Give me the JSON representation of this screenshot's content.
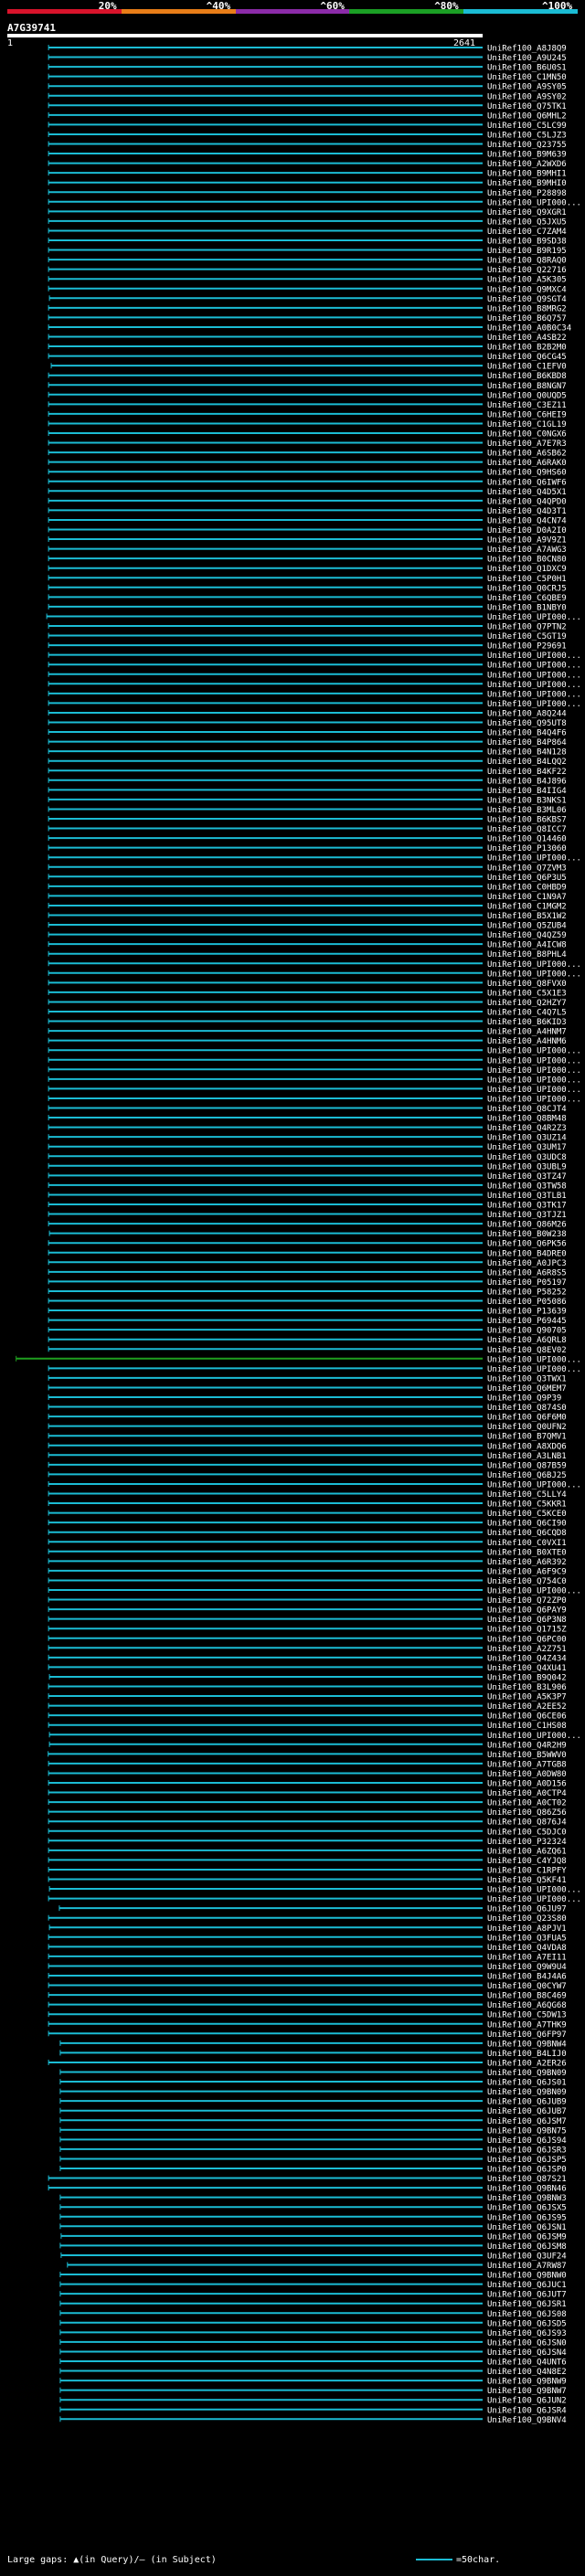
{
  "header": {
    "ticks": [
      "20%",
      "^40%",
      "^60%",
      "^80%",
      "^100%"
    ],
    "segment_colors": [
      "#d9132b",
      "#e87d18",
      "#8b2ba8",
      "#1b9f25",
      "#1bbcd4"
    ]
  },
  "query": {
    "id": "A7G39741",
    "start_label": "1",
    "end_label": "2641"
  },
  "colors": {
    "hit": "#1bbcd4",
    "gap_hit": "#1f9f1f",
    "query_bar": "#ffffff"
  },
  "footer": {
    "left": "Large gaps: ▲(in Query)/— (in Subject)",
    "right": "=50char."
  },
  "chart_data": {
    "type": "bar",
    "title": "A7G39741",
    "x_range": [
      1,
      2641
    ],
    "bar_end": 2641,
    "hits": [
      {
        "name": "UniRef100_A8J8Q9",
        "start": 230
      },
      {
        "name": "UniRef100_A9U245",
        "start": 230
      },
      {
        "name": "UniRef100_B6U0S1",
        "start": 230
      },
      {
        "name": "UniRef100_C1MN50",
        "start": 230
      },
      {
        "name": "UniRef100_A9SY05",
        "start": 230
      },
      {
        "name": "UniRef100_A9SY02",
        "start": 230
      },
      {
        "name": "UniRef100_Q75TK1",
        "start": 230
      },
      {
        "name": "UniRef100_Q6MHL2",
        "start": 230
      },
      {
        "name": "UniRef100_C5LC99",
        "start": 230
      },
      {
        "name": "UniRef100_C5LJZ3",
        "start": 230
      },
      {
        "name": "UniRef100_Q23755",
        "start": 230
      },
      {
        "name": "UniRef100_B9M639",
        "start": 230
      },
      {
        "name": "UniRef100_A2WXD6",
        "start": 230
      },
      {
        "name": "UniRef100_B9MHI1",
        "start": 230
      },
      {
        "name": "UniRef100_B9MHI0",
        "start": 230
      },
      {
        "name": "UniRef100_P28898",
        "start": 230
      },
      {
        "name": "UniRef100_UPI000...",
        "start": 230
      },
      {
        "name": "UniRef100_Q9XGR1",
        "start": 230
      },
      {
        "name": "UniRef100_Q5JXU5",
        "start": 230
      },
      {
        "name": "UniRef100_C7ZAM4",
        "start": 230
      },
      {
        "name": "UniRef100_B9SD38",
        "start": 230
      },
      {
        "name": "UniRef100_B9R195",
        "start": 230
      },
      {
        "name": "UniRef100_Q8RAQ0",
        "start": 230
      },
      {
        "name": "UniRef100_Q22716",
        "start": 230
      },
      {
        "name": "UniRef100_A5K305",
        "start": 230
      },
      {
        "name": "UniRef100_Q9MXC4",
        "start": 230
      },
      {
        "name": "UniRef100_Q9SGT4",
        "start": 235
      },
      {
        "name": "UniRef100_B8MRG2",
        "start": 230
      },
      {
        "name": "UniRef100_B6Q757",
        "start": 230
      },
      {
        "name": "UniRef100_A0B0C34",
        "start": 230
      },
      {
        "name": "UniRef100_A4SB22",
        "start": 230
      },
      {
        "name": "UniRef100_B2B2M0",
        "start": 230
      },
      {
        "name": "UniRef100_Q6CG45",
        "start": 230
      },
      {
        "name": "UniRef100_C1EFV0",
        "start": 245
      },
      {
        "name": "UniRef100_B6KBD8",
        "start": 230
      },
      {
        "name": "UniRef100_B8NGN7",
        "start": 230
      },
      {
        "name": "UniRef100_Q0UQD5",
        "start": 230
      },
      {
        "name": "UniRef100_C3EZ11",
        "start": 230
      },
      {
        "name": "UniRef100_C6HEI9",
        "start": 230
      },
      {
        "name": "UniRef100_C1GL19",
        "start": 230
      },
      {
        "name": "UniRef100_C0NGX6",
        "start": 230
      },
      {
        "name": "UniRef100_A7E7R3",
        "start": 230
      },
      {
        "name": "UniRef100_A6SB62",
        "start": 230
      },
      {
        "name": "UniRef100_A6RAK0",
        "start": 230
      },
      {
        "name": "UniRef100_Q9HS60",
        "start": 230
      },
      {
        "name": "UniRef100_Q6IWF6",
        "start": 230
      },
      {
        "name": "UniRef100_Q4D5X1",
        "start": 230
      },
      {
        "name": "UniRef100_Q4QPD0",
        "start": 230
      },
      {
        "name": "UniRef100_Q4D3T1",
        "start": 230
      },
      {
        "name": "UniRef100_Q4CN74",
        "start": 230
      },
      {
        "name": "UniRef100_D0A2I0",
        "start": 230
      },
      {
        "name": "UniRef100_A9V9Z1",
        "start": 230
      },
      {
        "name": "UniRef100_A7AWG3",
        "start": 230
      },
      {
        "name": "UniRef100_B0CN80",
        "start": 230
      },
      {
        "name": "UniRef100_Q1DXC9",
        "start": 230
      },
      {
        "name": "UniRef100_C5P0H1",
        "start": 230
      },
      {
        "name": "UniRef100_Q0CRJ5",
        "start": 230
      },
      {
        "name": "UniRef100_C6QBE9",
        "start": 230
      },
      {
        "name": "UniRef100_B1NBY0",
        "start": 230
      },
      {
        "name": "UniRef100_UPI000...",
        "start": 220
      },
      {
        "name": "UniRef100_Q7PTN2",
        "start": 230
      },
      {
        "name": "UniRef100_C5GT19",
        "start": 230
      },
      {
        "name": "UniRef100_P29691",
        "start": 230
      },
      {
        "name": "UniRef100_UPI000...",
        "start": 230
      },
      {
        "name": "UniRef100_UPI000...",
        "start": 230
      },
      {
        "name": "UniRef100_UPI000...",
        "start": 230
      },
      {
        "name": "UniRef100_UPI000...",
        "start": 230
      },
      {
        "name": "UniRef100_UPI000...",
        "start": 230
      },
      {
        "name": "UniRef100_UPI000...",
        "start": 230
      },
      {
        "name": "UniRef100_A8Q244",
        "start": 230
      },
      {
        "name": "UniRef100_Q95UT8",
        "start": 230
      },
      {
        "name": "UniRef100_B4Q4F6",
        "start": 230
      },
      {
        "name": "UniRef100_B4P864",
        "start": 230
      },
      {
        "name": "UniRef100_B4N128",
        "start": 230
      },
      {
        "name": "UniRef100_B4LQQ2",
        "start": 230
      },
      {
        "name": "UniRef100_B4KF22",
        "start": 230
      },
      {
        "name": "UniRef100_B4J896",
        "start": 230
      },
      {
        "name": "UniRef100_B4IIG4",
        "start": 230
      },
      {
        "name": "UniRef100_B3NKS1",
        "start": 230
      },
      {
        "name": "UniRef100_B3ML06",
        "start": 230
      },
      {
        "name": "UniRef100_B6KBS7",
        "start": 230
      },
      {
        "name": "UniRef100_Q8ICC7",
        "start": 230
      },
      {
        "name": "UniRef100_Q14460",
        "start": 230
      },
      {
        "name": "UniRef100_P13060",
        "start": 230
      },
      {
        "name": "UniRef100_UPI000...",
        "start": 230
      },
      {
        "name": "UniRef100_Q7ZVM3",
        "start": 230
      },
      {
        "name": "UniRef100_Q6P3U5",
        "start": 230
      },
      {
        "name": "UniRef100_C0HBD9",
        "start": 230
      },
      {
        "name": "UniRef100_C1N9A7",
        "start": 230
      },
      {
        "name": "UniRef100_C1MGM2",
        "start": 230
      },
      {
        "name": "UniRef100_B5X1W2",
        "start": 230
      },
      {
        "name": "UniRef100_Q5ZUB4",
        "start": 230
      },
      {
        "name": "UniRef100_Q4QZ59",
        "start": 230
      },
      {
        "name": "UniRef100_A4ICW8",
        "start": 230
      },
      {
        "name": "UniRef100_B8PHL4",
        "start": 230
      },
      {
        "name": "UniRef100_UPI000...",
        "start": 230
      },
      {
        "name": "UniRef100_UPI000...",
        "start": 230
      },
      {
        "name": "UniRef100_Q8FVX0",
        "start": 230
      },
      {
        "name": "UniRef100_C5X1E3",
        "start": 230
      },
      {
        "name": "UniRef100_Q2HZY7",
        "start": 230
      },
      {
        "name": "UniRef100_C4Q7L5",
        "start": 230
      },
      {
        "name": "UniRef100_B6KID3",
        "start": 230
      },
      {
        "name": "UniRef100_A4HNM7",
        "start": 230
      },
      {
        "name": "UniRef100_A4HNM6",
        "start": 230
      },
      {
        "name": "UniRef100_UPI000...",
        "start": 230
      },
      {
        "name": "UniRef100_UPI000...",
        "start": 230
      },
      {
        "name": "UniRef100_UPI000...",
        "start": 230
      },
      {
        "name": "UniRef100_UPI000...",
        "start": 230
      },
      {
        "name": "UniRef100_UPI000...",
        "start": 230
      },
      {
        "name": "UniRef100_UPI000...",
        "start": 230
      },
      {
        "name": "UniRef100_Q8CJT4",
        "start": 230
      },
      {
        "name": "UniRef100_Q8BM48",
        "start": 230
      },
      {
        "name": "UniRef100_Q4R2Z3",
        "start": 230
      },
      {
        "name": "UniRef100_Q3UZ14",
        "start": 230
      },
      {
        "name": "UniRef100_Q3UM17",
        "start": 230
      },
      {
        "name": "UniRef100_Q3UDC8",
        "start": 230
      },
      {
        "name": "UniRef100_Q3UBL9",
        "start": 230
      },
      {
        "name": "UniRef100_Q3TZ47",
        "start": 230
      },
      {
        "name": "UniRef100_Q3TW58",
        "start": 230
      },
      {
        "name": "UniRef100_Q3TLB1",
        "start": 230
      },
      {
        "name": "UniRef100_Q3TK17",
        "start": 230
      },
      {
        "name": "UniRef100_Q3TJZ1",
        "start": 230
      },
      {
        "name": "UniRef100_Q86M26",
        "start": 230
      },
      {
        "name": "UniRef100_B0W238",
        "start": 235
      },
      {
        "name": "UniRef100_Q6PK56",
        "start": 230
      },
      {
        "name": "UniRef100_B4DRE0",
        "start": 230
      },
      {
        "name": "UniRef100_A0JPC3",
        "start": 230
      },
      {
        "name": "UniRef100_A6R8S5",
        "start": 230
      },
      {
        "name": "UniRef100_P05197",
        "start": 230
      },
      {
        "name": "UniRef100_P58252",
        "start": 230
      },
      {
        "name": "UniRef100_P05086",
        "start": 230
      },
      {
        "name": "UniRef100_P13639",
        "start": 230
      },
      {
        "name": "UniRef100_P69445",
        "start": 230
      },
      {
        "name": "UniRef100_Q90705",
        "start": 230
      },
      {
        "name": "UniRef100_A6QRL8",
        "start": 230
      },
      {
        "name": "UniRef100_Q8EV02",
        "start": 230
      },
      {
        "name": "UniRef100_UPI000...",
        "start": 50,
        "gap": true
      },
      {
        "name": "UniRef100_UPI000...",
        "start": 230
      },
      {
        "name": "UniRef100_Q3TWX1",
        "start": 230
      },
      {
        "name": "UniRef100_Q6MEM7",
        "start": 230
      },
      {
        "name": "UniRef100_Q9P39",
        "start": 230
      },
      {
        "name": "UniRef100_Q874S0",
        "start": 230
      },
      {
        "name": "UniRef100_Q6F6M0",
        "start": 230
      },
      {
        "name": "UniRef100_Q0UFN2",
        "start": 230
      },
      {
        "name": "UniRef100_B7QMV1",
        "start": 230
      },
      {
        "name": "UniRef100_A8XDQ6",
        "start": 230
      },
      {
        "name": "UniRef100_A3LNB1",
        "start": 230
      },
      {
        "name": "UniRef100_Q87B59",
        "start": 230
      },
      {
        "name": "UniRef100_Q6BJ25",
        "start": 230
      },
      {
        "name": "UniRef100_UPI000...",
        "start": 230
      },
      {
        "name": "UniRef100_C5LLY4",
        "start": 230
      },
      {
        "name": "UniRef100_C5KKR1",
        "start": 230
      },
      {
        "name": "UniRef100_C5KCE0",
        "start": 230
      },
      {
        "name": "UniRef100_Q6CI90",
        "start": 230
      },
      {
        "name": "UniRef100_Q6CQD8",
        "start": 230
      },
      {
        "name": "UniRef100_C0VXI1",
        "start": 230
      },
      {
        "name": "UniRef100_B0XTE0",
        "start": 230
      },
      {
        "name": "UniRef100_A6R392",
        "start": 230
      },
      {
        "name": "UniRef100_A6F9C9",
        "start": 230
      },
      {
        "name": "UniRef100_Q754C0",
        "start": 230
      },
      {
        "name": "UniRef100_UPI000...",
        "start": 230
      },
      {
        "name": "UniRef100_Q72ZP0",
        "start": 230
      },
      {
        "name": "UniRef100_Q6PAY9",
        "start": 230
      },
      {
        "name": "UniRef100_Q6P3N8",
        "start": 230
      },
      {
        "name": "UniRef100_Q1715Z",
        "start": 230
      },
      {
        "name": "UniRef100_Q6PC00",
        "start": 230
      },
      {
        "name": "UniRef100_A2Z751",
        "start": 230
      },
      {
        "name": "UniRef100_Q4Z434",
        "start": 230
      },
      {
        "name": "UniRef100_Q4XU41",
        "start": 230
      },
      {
        "name": "UniRef100_B9Q042",
        "start": 235
      },
      {
        "name": "UniRef100_B3L906",
        "start": 230
      },
      {
        "name": "UniRef100_A5K3P7",
        "start": 230
      },
      {
        "name": "UniRef100_A2EE52",
        "start": 230
      },
      {
        "name": "UniRef100_Q6CE06",
        "start": 230
      },
      {
        "name": "UniRef100_C1HS08",
        "start": 230
      },
      {
        "name": "UniRef100_UPI000...",
        "start": 235
      },
      {
        "name": "UniRef100_Q4R2H9",
        "start": 235
      },
      {
        "name": "UniRef100_B5WWV0",
        "start": 228
      },
      {
        "name": "UniRef100_A7TGB8",
        "start": 230
      },
      {
        "name": "UniRef100_A0DW80",
        "start": 230
      },
      {
        "name": "UniRef100_A0D156",
        "start": 230
      },
      {
        "name": "UniRef100_A0CTP4",
        "start": 230
      },
      {
        "name": "UniRef100_A0CT02",
        "start": 230
      },
      {
        "name": "UniRef100_Q86Z56",
        "start": 230
      },
      {
        "name": "UniRef100_Q876J4",
        "start": 230
      },
      {
        "name": "UniRef100_C5DJC0",
        "start": 230
      },
      {
        "name": "UniRef100_P32324",
        "start": 230
      },
      {
        "name": "UniRef100_A6ZQ61",
        "start": 230
      },
      {
        "name": "UniRef100_C4YJQ8",
        "start": 230
      },
      {
        "name": "UniRef100_C1RPFY",
        "start": 230
      },
      {
        "name": "UniRef100_Q5KF41",
        "start": 230
      },
      {
        "name": "UniRef100_UPI000...",
        "start": 235
      },
      {
        "name": "UniRef100_UPI000...",
        "start": 230
      },
      {
        "name": "UniRef100_Q6JU97",
        "start": 290
      },
      {
        "name": "UniRef100_Q23S80",
        "start": 230
      },
      {
        "name": "UniRef100_A8PJV1",
        "start": 235
      },
      {
        "name": "UniRef100_Q3FUA5",
        "start": 230
      },
      {
        "name": "UniRef100_Q4VDA8",
        "start": 230
      },
      {
        "name": "UniRef100_A7EI11",
        "start": 230
      },
      {
        "name": "UniRef100_Q9W9U4",
        "start": 230
      },
      {
        "name": "UniRef100_B4J4A6",
        "start": 230
      },
      {
        "name": "UniRef100_Q0CYW7",
        "start": 230
      },
      {
        "name": "UniRef100_B8C469",
        "start": 230
      },
      {
        "name": "UniRef100_A6QG68",
        "start": 230
      },
      {
        "name": "UniRef100_C5DW13",
        "start": 230
      },
      {
        "name": "UniRef100_A7THK9",
        "start": 230
      },
      {
        "name": "UniRef100_Q6FP97",
        "start": 230
      },
      {
        "name": "UniRef100_Q9BNW4",
        "start": 295
      },
      {
        "name": "UniRef100_B4LIJ0",
        "start": 295
      },
      {
        "name": "UniRef100_A2ER26",
        "start": 230
      },
      {
        "name": "UniRef100_Q9BN09",
        "start": 295
      },
      {
        "name": "UniRef100_Q6JS01",
        "start": 295
      },
      {
        "name": "UniRef100_Q9BN09",
        "start": 295
      },
      {
        "name": "UniRef100_Q6JUB9",
        "start": 295
      },
      {
        "name": "UniRef100_Q6JUB7",
        "start": 295
      },
      {
        "name": "UniRef100_Q6JSM7",
        "start": 295
      },
      {
        "name": "UniRef100_Q9BN75",
        "start": 295
      },
      {
        "name": "UniRef100_Q6JS94",
        "start": 295
      },
      {
        "name": "UniRef100_Q6JSR3",
        "start": 295
      },
      {
        "name": "UniRef100_Q6JSP5",
        "start": 295
      },
      {
        "name": "UniRef100_Q6JSP0",
        "start": 295
      },
      {
        "name": "UniRef100_Q87S21",
        "start": 230
      },
      {
        "name": "UniRef100_Q9BN46",
        "start": 230
      },
      {
        "name": "UniRef100_Q9BNW3",
        "start": 295
      },
      {
        "name": "UniRef100_Q6JSX5",
        "start": 295
      },
      {
        "name": "UniRef100_Q6JS95",
        "start": 295
      },
      {
        "name": "UniRef100_Q6JSN1",
        "start": 295
      },
      {
        "name": "UniRef100_Q6JSM9",
        "start": 300
      },
      {
        "name": "UniRef100_Q6JSM8",
        "start": 295
      },
      {
        "name": "UniRef100_Q3UF24",
        "start": 300
      },
      {
        "name": "UniRef100_A7RW87",
        "start": 335
      },
      {
        "name": "UniRef100_Q9BNW0",
        "start": 295
      },
      {
        "name": "UniRef100_Q6JUC1",
        "start": 295
      },
      {
        "name": "UniRef100_Q6JUT7",
        "start": 295
      },
      {
        "name": "UniRef100_Q6JSR1",
        "start": 295
      },
      {
        "name": "UniRef100_Q6JS08",
        "start": 295
      },
      {
        "name": "UniRef100_Q6JSD5",
        "start": 295
      },
      {
        "name": "UniRef100_Q6JS93",
        "start": 295
      },
      {
        "name": "UniRef100_Q6JSN0",
        "start": 295
      },
      {
        "name": "UniRef100_Q6JSN4",
        "start": 295
      },
      {
        "name": "UniRef100_Q4UNT6",
        "start": 295
      },
      {
        "name": "UniRef100_Q4N8E2",
        "start": 295
      },
      {
        "name": "UniRef100_Q9BNW9",
        "start": 295
      },
      {
        "name": "UniRef100_Q9BNW7",
        "start": 295
      },
      {
        "name": "UniRef100_Q6JUN2",
        "start": 295
      },
      {
        "name": "UniRef100_Q6JSR4",
        "start": 295
      },
      {
        "name": "UniRef100_Q9BNV4",
        "start": 295
      }
    ]
  }
}
